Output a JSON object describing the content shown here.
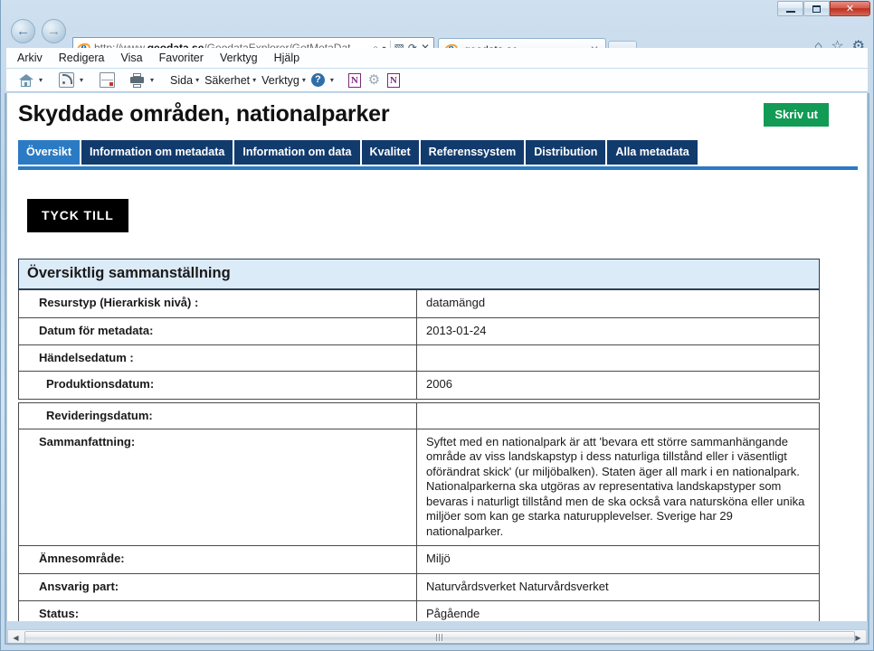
{
  "window": {
    "minimize_label": "Minimera",
    "maximize_label": "Maximera",
    "close_label": "✕"
  },
  "browser": {
    "back_label": "←",
    "forward_label": "→",
    "address": {
      "protocol_prefix": "http://www.",
      "domain": "geodata.se",
      "path": "/GeodataExplorer/GetMetaDat",
      "search_icon": "⌕",
      "dropdown_caret": "▾",
      "compat_icon": "▧",
      "refresh_icon": "⟳",
      "stop_icon": "✕"
    },
    "tab": {
      "title": "geodata.se",
      "close_label": "✕"
    },
    "right_icons": {
      "home": "⌂",
      "favorites": "☆",
      "tools": "⚙"
    },
    "menu": [
      "Arkiv",
      "Redigera",
      "Visa",
      "Favoriter",
      "Verktyg",
      "Hjälp"
    ],
    "command_bar": {
      "home_caret": "▾",
      "feeds_caret": "▾",
      "print_caret": "▾",
      "page_label": "Sida",
      "safety_label": "Säkerhet",
      "tools_label": "Verktyg",
      "help_label": "?",
      "help_caret": "▾",
      "onenote_label": "N",
      "onenote2_label": "N",
      "gear_label": "⚙",
      "caret": "▾"
    }
  },
  "page": {
    "title": "Skyddade områden, nationalparker",
    "print_button": "Skriv ut",
    "feedback_button": "TYCK TILL",
    "tabs": [
      {
        "label": "Översikt",
        "active": true
      },
      {
        "label": "Information om metadata",
        "active": false
      },
      {
        "label": "Information om data",
        "active": false
      },
      {
        "label": "Kvalitet",
        "active": false
      },
      {
        "label": "Referenssystem",
        "active": false
      },
      {
        "label": "Distribution",
        "active": false
      },
      {
        "label": "Alla metadata",
        "active": false
      }
    ],
    "table": {
      "header": "Översiktlig sammanställning",
      "rows": [
        {
          "key": "Resurstyp (Hierarkisk nivå) :",
          "value": "datamängd",
          "indent": false
        },
        {
          "key": "Datum för metadata:",
          "value": "2013-01-24",
          "indent": false
        },
        {
          "key": "Händelsedatum :",
          "value": "",
          "indent": false
        },
        {
          "key": "Produktionsdatum:",
          "value": "2006",
          "indent": true
        },
        {
          "key": "Revideringsdatum:",
          "value": "",
          "indent": true,
          "gap_before": true
        },
        {
          "key": "Sammanfattning:",
          "value": "Syftet med en nationalpark är att 'bevara ett större sammanhängande område av viss landskapstyp i dess naturliga tillstånd eller i väsentligt oförändrat skick' (ur miljöbalken). Staten äger all mark i en nationalpark. Nationalparkerna ska utgöras av representativa landskapstyper som bevaras i naturligt tillstånd men de ska också vara natursköna eller unika miljöer som kan ge starka naturupplevelser. Sverige har 29 nationalparker.",
          "indent": false
        },
        {
          "key": "Ämnesområde:",
          "value": "Miljö",
          "indent": false
        },
        {
          "key": "Ansvarig part:",
          "value": "Naturvårdsverket Naturvårdsverket",
          "indent": false
        },
        {
          "key": "Status:",
          "value": "Pågående",
          "indent": false
        }
      ]
    }
  },
  "scrollbar": {
    "left_arrow": "◀",
    "right_arrow": "▶"
  },
  "colors": {
    "tab_active": "#2b7ac4",
    "tab_inactive": "#123b6d",
    "print_green": "#119b54",
    "table_header_bg": "#dcebf8"
  }
}
